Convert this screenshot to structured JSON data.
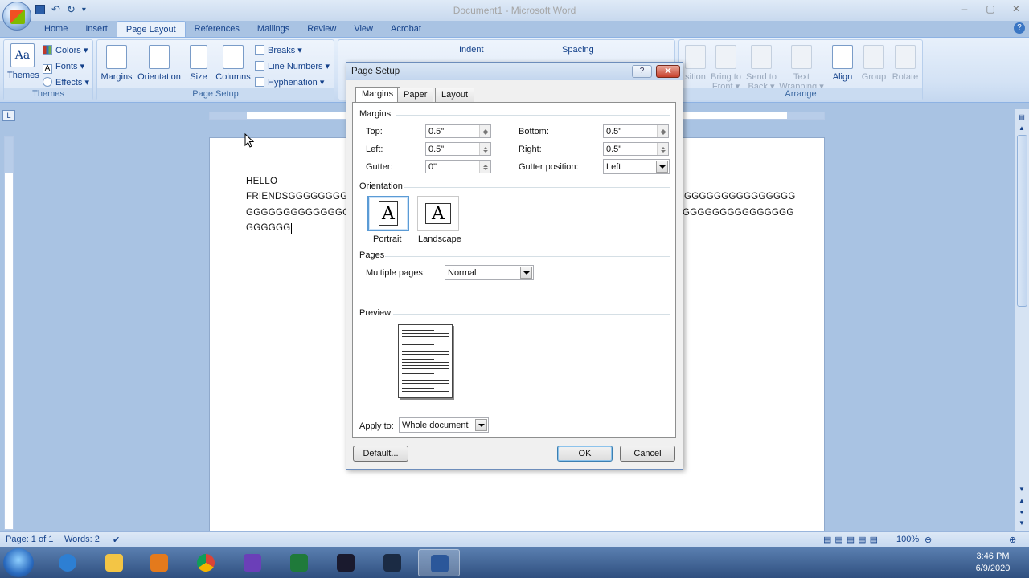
{
  "app": {
    "window_title": "Document1 - Microsoft Word",
    "qat": {
      "save": "save-icon",
      "undo": "↶",
      "redo": "↻",
      "customize": "▾"
    },
    "window_buttons": [
      "–",
      "▢",
      "✕"
    ]
  },
  "tabs": [
    "Home",
    "Insert",
    "Page Layout",
    "References",
    "Mailings",
    "Review",
    "View",
    "Acrobat"
  ],
  "active_tab": "Page Layout",
  "ribbon": {
    "themes_group": {
      "label": "Themes",
      "themes": "Themes",
      "colors": "Colors ▾",
      "fonts": "Fonts ▾",
      "effects": "Effects ▾"
    },
    "page_setup_group": {
      "label": "Page Setup",
      "margins": "Margins",
      "orientation": "Orientation",
      "size": "Size",
      "columns": "Columns",
      "breaks": "Breaks ▾",
      "line_numbers": "Line Numbers ▾",
      "hyphenation": "Hyphenation ▾"
    },
    "paragraph_group": {
      "indent": "Indent",
      "spacing": "Spacing"
    },
    "arrange_group": {
      "label": "Arrange",
      "position": "sition",
      "bring_to_front": "Bring to Front ▾",
      "send_to_back": "Send to Back ▾",
      "text_wrapping": "Text Wrapping ▾",
      "align": "Align",
      "group": "Group",
      "rotate": "Rotate"
    }
  },
  "document": {
    "lines": [
      "HELLO",
      "FRIENDSGGGGGGGGG",
      "GGGGGGGGGGGGGG",
      "GGGGGG"
    ],
    "right_lines": [
      "GGGGGGGGGGGGGGG",
      "GGGGGGGGGGGGGGG"
    ]
  },
  "status_bar": {
    "page": "Page: 1 of 1",
    "words": "Words: 2",
    "zoom": "100%"
  },
  "taskbar": {
    "clock_time": "3:46 PM",
    "clock_date": "6/9/2020"
  },
  "dialog": {
    "title": "Page Setup",
    "help": "?",
    "close": "✕",
    "tabs": [
      "Margins",
      "Paper",
      "Layout"
    ],
    "active_tab": "Margins",
    "margins_section": "Margins",
    "fields": {
      "top": {
        "label": "Top:",
        "value": "0.5\""
      },
      "bottom": {
        "label": "Bottom:",
        "value": "0.5\""
      },
      "left": {
        "label": "Left:",
        "value": "0.5\""
      },
      "right": {
        "label": "Right:",
        "value": "0.5\""
      },
      "gutter": {
        "label": "Gutter:",
        "value": "0\""
      },
      "gutter_position": {
        "label": "Gutter position:",
        "value": "Left"
      }
    },
    "orientation_section": "Orientation",
    "portrait": "Portrait",
    "landscape": "Landscape",
    "orientation_glyph": "A",
    "selected_orientation": "Portrait",
    "pages_section": "Pages",
    "multiple_pages": {
      "label": "Multiple pages:",
      "value": "Normal"
    },
    "preview_section": "Preview",
    "apply_to": {
      "label": "Apply to:",
      "value": "Whole document"
    },
    "default_button": "Default...",
    "ok_button": "OK",
    "cancel_button": "Cancel"
  }
}
